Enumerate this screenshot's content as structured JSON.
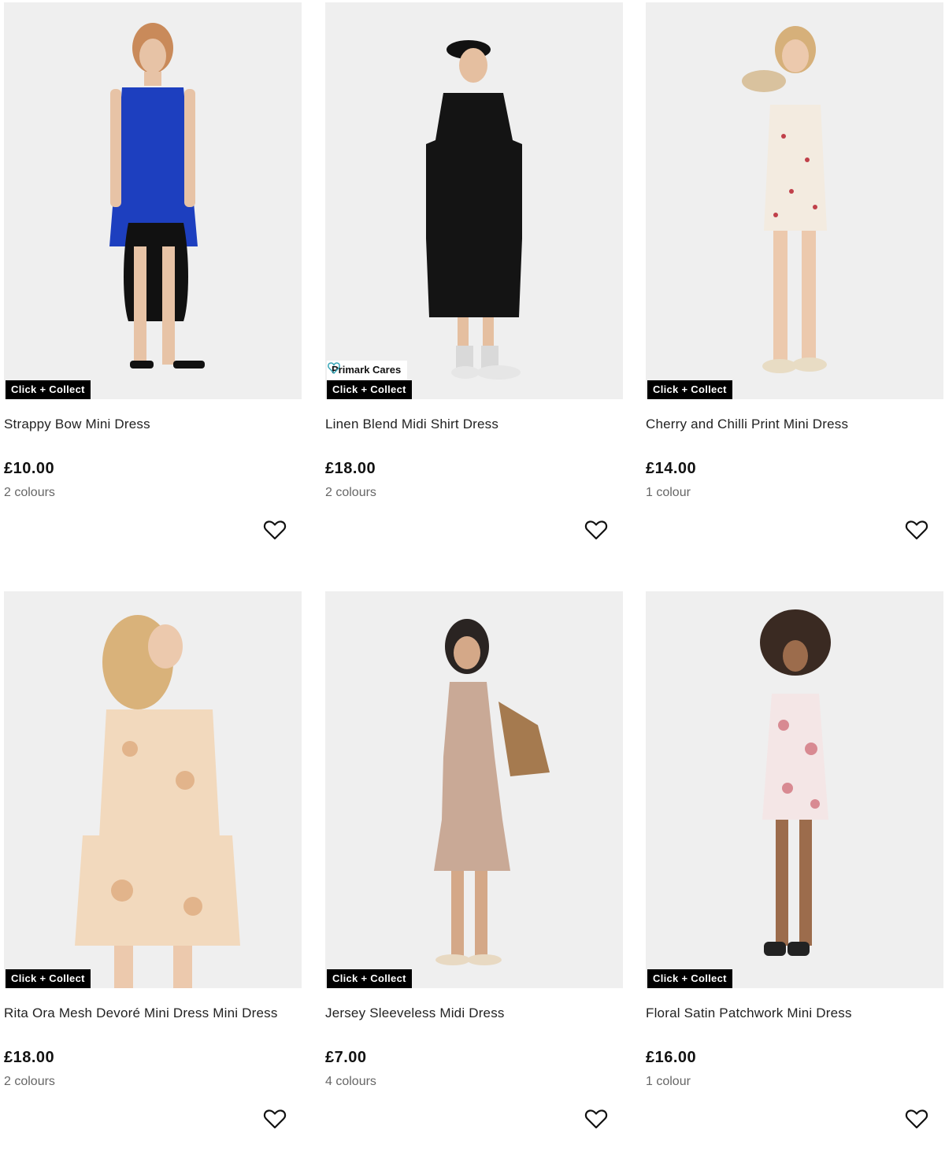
{
  "products": [
    {
      "title": "Strappy Bow Mini Dress",
      "price": "£10.00",
      "colours": "2 colours",
      "badge": "Click + Collect",
      "dress_color": "#1d3fbf"
    },
    {
      "title": "Linen Blend Midi Shirt Dress",
      "price": "£18.00",
      "colours": "2 colours",
      "badge": "Click + Collect",
      "cares_label": "Primark Cares",
      "dress_color": "#141414"
    },
    {
      "title": "Cherry and Chilli Print Mini Dress",
      "price": "£14.00",
      "colours": "1 colour",
      "badge": "Click + Collect",
      "dress_color": "#f3ebe0"
    },
    {
      "title": "Rita Ora Mesh Devoré Mini Dress Mini Dress",
      "price": "£18.00",
      "colours": "2 colours",
      "badge": "Click + Collect",
      "dress_color": "#f2d9bd"
    },
    {
      "title": "Jersey Sleeveless Midi Dress",
      "price": "£7.00",
      "colours": "4 colours",
      "badge": "Click + Collect",
      "dress_color": "#c9a996"
    },
    {
      "title": "Floral Satin Patchwork Mini Dress",
      "price": "£16.00",
      "colours": "1 colour",
      "badge": "Click + Collect",
      "dress_color": "#f4e6e6"
    }
  ],
  "icons": {
    "favourite": "heart-outline-icon",
    "cares": "heart-leaf-icon"
  },
  "colors": {
    "badge_bg": "#000000",
    "image_bg": "#efefef",
    "cares_icon": "#3aa7b8"
  }
}
